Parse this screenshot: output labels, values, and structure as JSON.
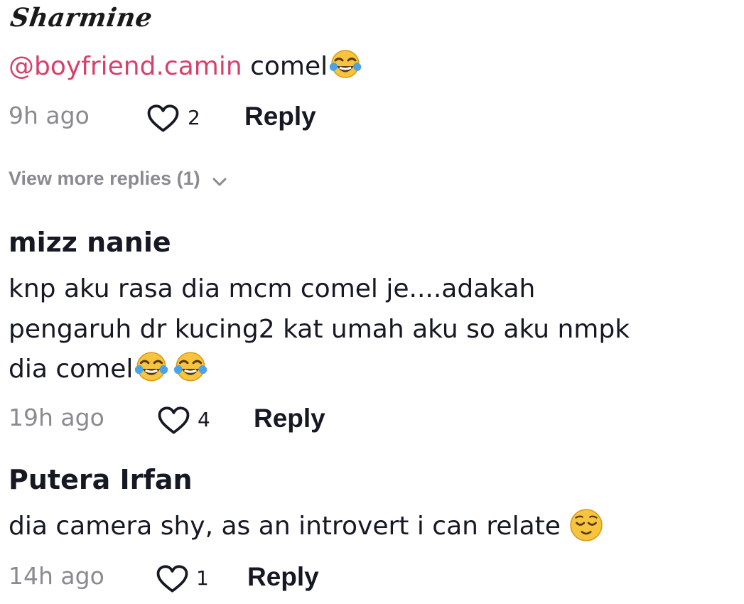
{
  "comments": [
    {
      "username": "Sharmine",
      "mention": "@boyfriend.camin",
      "text": " comel",
      "emoji": [
        "tears-of-joy-emoji"
      ],
      "time": "9h ago",
      "likes": "2",
      "reply_label": "Reply"
    },
    {
      "username": "mizz nanie",
      "text_lines": [
        "knp aku rasa dia mcm comel je....adakah",
        "pengaruh dr kucing2 kat umah aku so aku nmpk",
        "dia comel"
      ],
      "emoji": [
        "tears-of-joy-emoji",
        "tears-of-joy-emoji"
      ],
      "time": "19h ago",
      "likes": "4",
      "reply_label": "Reply"
    },
    {
      "username": "Putera Irfan",
      "text": "dia camera shy, as an introvert i can relate ",
      "emoji": [
        "relieved-face-emoji"
      ],
      "time": "14h ago",
      "likes": "1",
      "reply_label": "Reply"
    }
  ],
  "view_more_replies": "View more replies (1)",
  "icons": {
    "like": "heart-outline-icon",
    "expand": "chevron-down-icon"
  },
  "colors": {
    "mention": "#d6416b",
    "muted": "#8a8b91",
    "text": "#161823",
    "emoji_face": "#f7c53d"
  }
}
